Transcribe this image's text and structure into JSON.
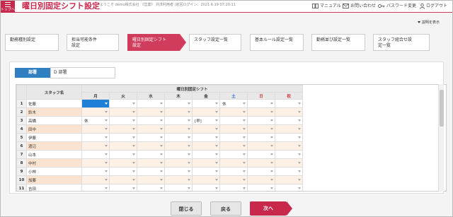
{
  "header": {
    "menu_label": "トップへ",
    "title": "曜日別固定シフト設定",
    "subtitle": "ようこそ demo株式会社 《営業》 共済利用者 (前回ログイン：2021.6.19 07:20:11",
    "links": [
      {
        "label": "マニュアル",
        "icon": "book-icon"
      },
      {
        "label": "お問い合わせ",
        "icon": "mail-icon"
      },
      {
        "label": "パスワード変更",
        "icon": "key-icon"
      },
      {
        "label": "ログアウト",
        "icon": "user-icon"
      }
    ]
  },
  "description_toggle": "説明を表示",
  "steps": [
    {
      "line1": "勤務種別設定",
      "line2": "",
      "active": false
    },
    {
      "line1": "担当可能条件",
      "line2": "設定",
      "active": false
    },
    {
      "line1": "曜日別固定シフト",
      "line2": "設定",
      "active": true
    },
    {
      "line1": "スタッフ設定一覧",
      "line2": "",
      "active": false
    },
    {
      "line1": "基本ルール設定一覧",
      "line2": "",
      "active": false
    },
    {
      "line1": "勤務並び設定一覧",
      "line2": "",
      "active": false
    },
    {
      "line1": "スタッフ組合せ設",
      "line2": "定一覧",
      "active": false
    }
  ],
  "department": {
    "label": "部署",
    "value": "D 部署"
  },
  "table": {
    "group_header": "曜日別固定シフト",
    "staff_header": "スタッフ名",
    "days": [
      "月",
      "火",
      "水",
      "木",
      "金",
      "土",
      "日",
      "祝"
    ],
    "rows": [
      {
        "no": "1",
        "name": "佐藤",
        "cells": [
          "",
          "",
          "",
          "",
          "",
          "休",
          "",
          ""
        ]
      },
      {
        "no": "2",
        "name": "鈴木",
        "cells": [
          "",
          "",
          "",
          "",
          "",
          "",
          "",
          ""
        ]
      },
      {
        "no": "3",
        "name": "高橋",
        "cells": [
          "休",
          "",
          "",
          "",
          "[早]",
          "",
          "",
          ""
        ]
      },
      {
        "no": "4",
        "name": "田中",
        "cells": [
          "",
          "",
          "",
          "",
          "",
          "",
          "",
          ""
        ]
      },
      {
        "no": "5",
        "name": "伊藤",
        "cells": [
          "",
          "",
          "",
          "",
          "",
          "",
          "",
          ""
        ]
      },
      {
        "no": "6",
        "name": "渡辺",
        "cells": [
          "",
          "",
          "",
          "",
          "",
          "",
          "",
          ""
        ]
      },
      {
        "no": "7",
        "name": "山本",
        "cells": [
          "",
          "",
          "",
          "",
          "",
          "",
          "",
          ""
        ]
      },
      {
        "no": "8",
        "name": "中村",
        "cells": [
          "",
          "",
          "",
          "",
          "",
          "",
          "",
          ""
        ]
      },
      {
        "no": "9",
        "name": "小林",
        "cells": [
          "",
          "",
          "",
          "",
          "",
          "",
          "",
          ""
        ]
      },
      {
        "no": "10",
        "name": "加藤",
        "cells": [
          "",
          "",
          "",
          "",
          "",
          "",
          "",
          ""
        ]
      },
      {
        "no": "11",
        "name": "吉田",
        "cells": [
          "",
          "",
          "",
          "",
          "",
          "",
          "",
          ""
        ]
      }
    ]
  },
  "footer": {
    "close": "閉じる",
    "back": "戻る",
    "next": "次へ"
  },
  "colors": {
    "brand": "#c8284c",
    "accent_blue": "#2f7fc1",
    "row_alt": "#fbe3cf"
  }
}
